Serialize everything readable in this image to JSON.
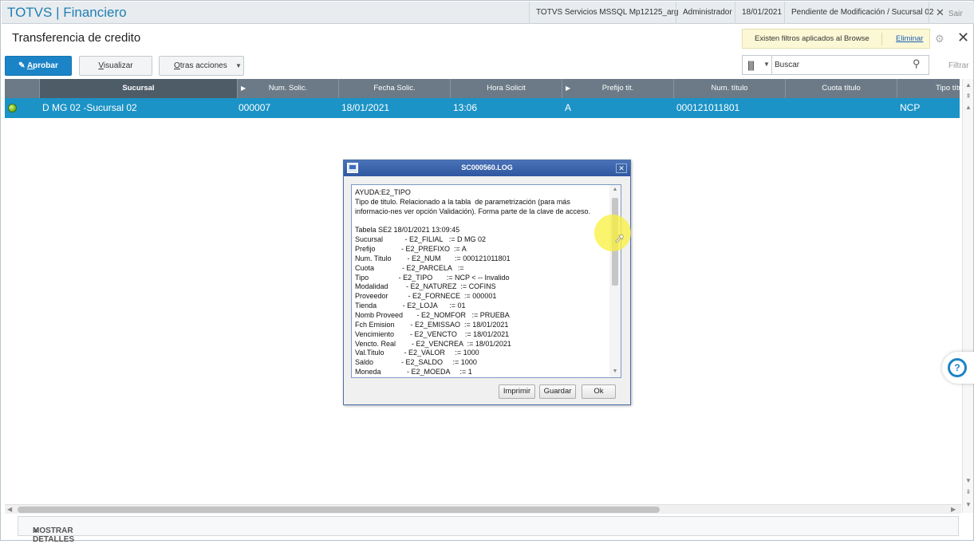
{
  "topbar": {
    "brand": "TOTVS | Financiero",
    "environment": "TOTVS Servicios MSSQL Mp12125_arg",
    "user": "Administrador",
    "date": "18/01/2021",
    "branch_status": "Pendiente de Modificación / Sucursal 02",
    "exit_label": "Sair"
  },
  "page": {
    "title": "Transferencia de credito",
    "filter_notice": "Existen filtros aplicados al Browse",
    "filter_remove_link": "Eliminar"
  },
  "toolbar": {
    "approve_label": "Aprobar",
    "approve_underlined": "A",
    "approve_rest": "probar",
    "view_underlined": "V",
    "view_rest": "isualizar",
    "other_underlined": "O",
    "other_rest": "tras acciones",
    "search_placeholder": "Buscar",
    "filter_label": "Filtrar"
  },
  "grid": {
    "columns": [
      "Sucursal",
      "Num. Solic.",
      "Fecha Solic.",
      "Hora Solicit",
      "Prefijo tit.",
      "Num. título",
      "Cuota título",
      "Tipo título"
    ],
    "rows": [
      {
        "status": "green",
        "sucursal": "D MG 02 -Sucursal 02",
        "num_solic": "000007",
        "fecha_solic": "18/01/2021",
        "hora_solicit": "13:06",
        "prefijo": "A",
        "num_titulo": "000121011801",
        "cuota_titulo": "",
        "tipo_titulo": "NCP"
      }
    ]
  },
  "footer": {
    "details_label": "MOSTRAR DETALLES"
  },
  "dialog": {
    "title": "SC000560.LOG",
    "log_lines": [
      "AYUDA:E2_TIPO",
      "Tipo de titulo. Relacionado a la tabla  de parametrización (para más",
      "informacio-nes ver opción Validación). Forma parte de la clave de acceso.",
      "",
      "Tabela SE2 18/01/2021 13:09:45",
      "Sucursal           - E2_FILIAL   := D MG 02",
      "Prefijo             - E2_PREFIXO  := A",
      "Num. Titulo        - E2_NUM       := 000121011801",
      "Cuota              - E2_PARCELA   :=",
      "Tipo               - E2_TIPO       := NCP < -- Invalido",
      "Modalidad         - E2_NATUREZ  := COFINS",
      "Proveedor          - E2_FORNECE  := 000001",
      "Tienda             - E2_LOJA      := 01",
      "Nomb Proveed       - E2_NOMFOR   := PRUEBA",
      "Fch Emision        - E2_EMISSAO  := 18/01/2021",
      "Vencimiento        - E2_VENCTO    := 18/01/2021",
      "Vencto. Real        - E2_VENCREA  := 18/01/2021",
      "Val.Titulo          - E2_VALOR     := 1000",
      "Saldo              - E2_SALDO     := 1000",
      "Moneda             - E2_MOEDA     := 1"
    ],
    "print_label": "Imprimir",
    "save_label": "Guardar",
    "ok_label": "Ok"
  }
}
